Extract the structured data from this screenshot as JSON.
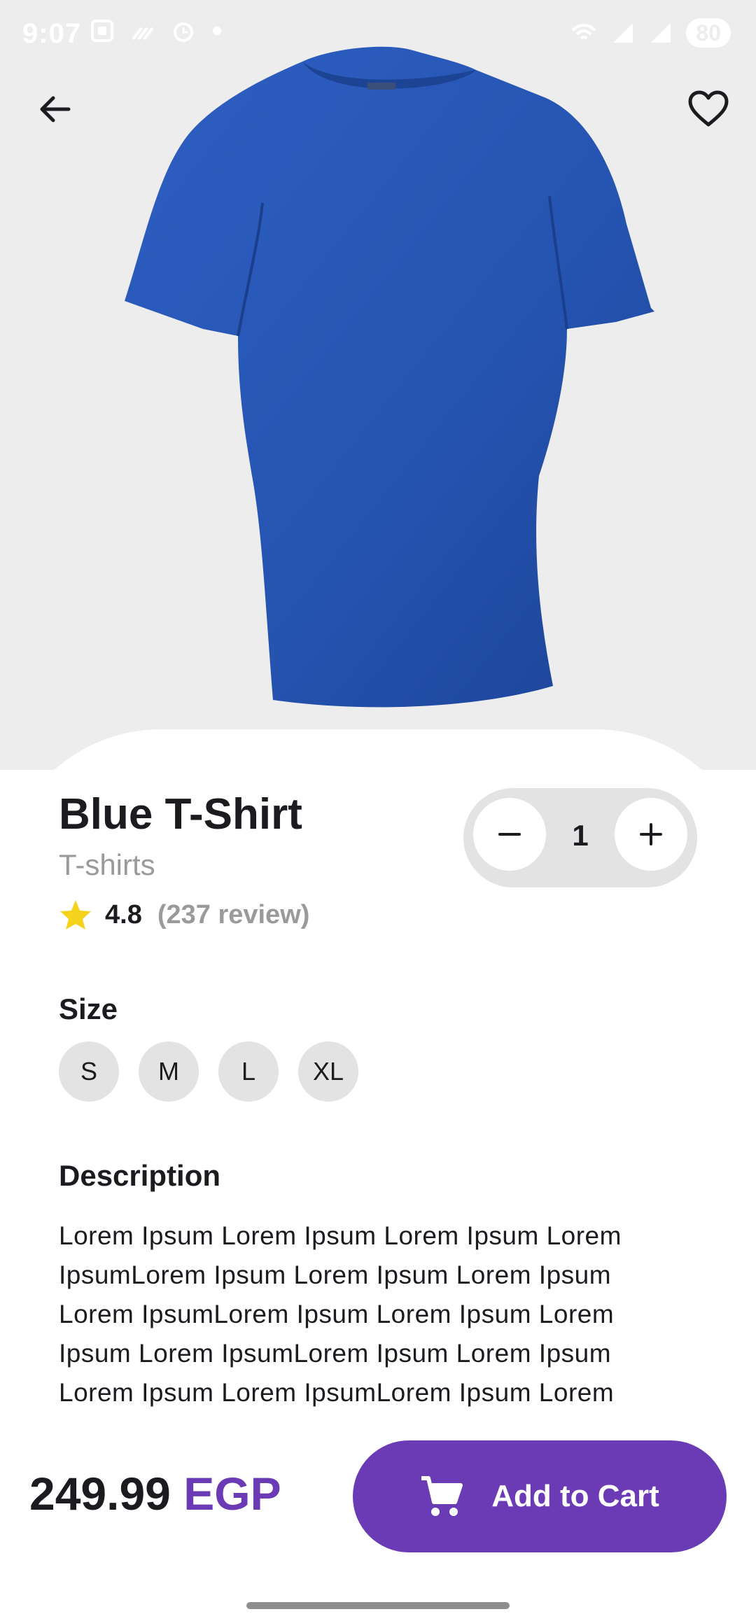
{
  "status_bar": {
    "time": "9:07",
    "battery": "80"
  },
  "product": {
    "title": "Blue T-Shirt",
    "category": "T-shirts",
    "rating": "4.8",
    "reviews": "(237 review)",
    "quantity": "1",
    "image_icon": "tshirt-image"
  },
  "sizes": {
    "label": "Size",
    "options": [
      "S",
      "M",
      "L",
      "XL"
    ]
  },
  "description": {
    "label": "Description",
    "text": "Lorem Ipsum Lorem Ipsum Lorem Ipsum Lorem IpsumLorem Ipsum Lorem Ipsum Lorem Ipsum Lorem IpsumLorem Ipsum Lorem Ipsum Lorem Ipsum Lorem IpsumLorem Ipsum Lorem Ipsum Lorem Ipsum Lorem IpsumLorem Ipsum Lorem"
  },
  "footer": {
    "price": "249.99",
    "currency": "EGP",
    "cart_label": "Add to Cart"
  },
  "colors": {
    "accent": "#6a3bb5",
    "shirt": "#2b59b8",
    "star": "#f5d21c",
    "muted": "#9a9a9a"
  }
}
